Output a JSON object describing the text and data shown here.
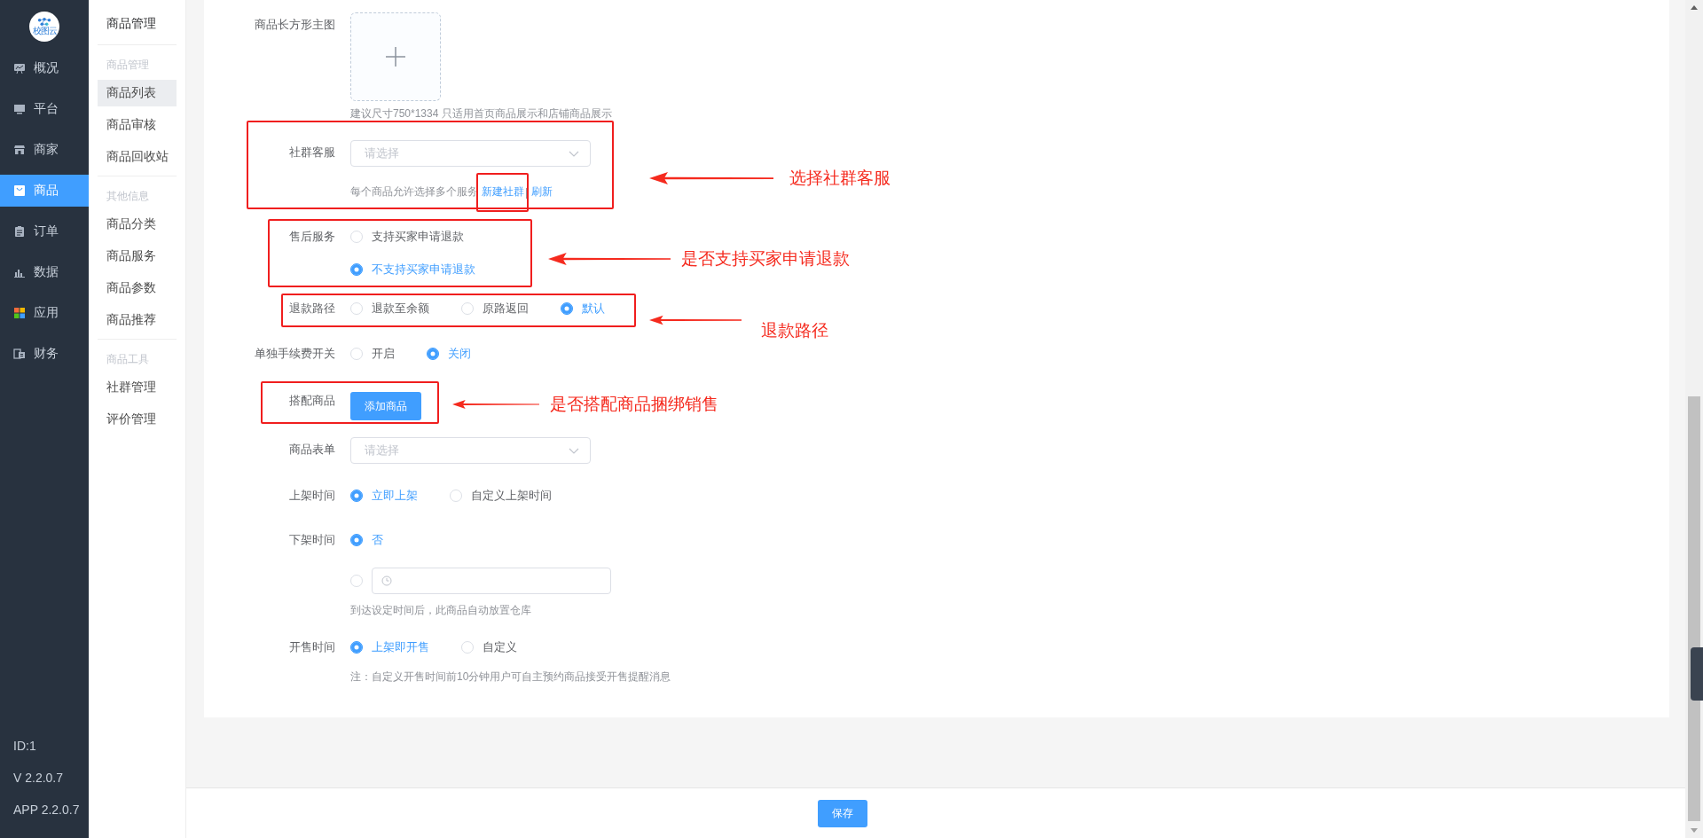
{
  "logo": {
    "text": "校图云"
  },
  "nav": [
    {
      "label": "概况",
      "selected": false
    },
    {
      "label": "平台",
      "selected": false
    },
    {
      "label": "商家",
      "selected": false
    },
    {
      "label": "商品",
      "selected": true
    },
    {
      "label": "订单",
      "selected": false
    },
    {
      "label": "数据",
      "selected": false
    },
    {
      "label": "应用",
      "selected": false
    },
    {
      "label": "财务",
      "selected": false
    }
  ],
  "nav_footer": [
    "ID:1",
    "V 2.2.0.7",
    "APP 2.2.0.7"
  ],
  "submenu": {
    "title": "商品管理",
    "groups": [
      {
        "heading": "商品管理",
        "items": [
          {
            "label": "商品列表",
            "selected": true
          },
          {
            "label": "商品审核",
            "selected": false
          },
          {
            "label": "商品回收站",
            "selected": false
          }
        ]
      },
      {
        "heading": "其他信息",
        "items": [
          {
            "label": "商品分类",
            "selected": false
          },
          {
            "label": "商品服务",
            "selected": false
          },
          {
            "label": "商品参数",
            "selected": false
          },
          {
            "label": "商品推荐",
            "selected": false
          }
        ]
      },
      {
        "heading": "商品工具",
        "items": [
          {
            "label": "社群管理",
            "selected": false
          },
          {
            "label": "评价管理",
            "selected": false
          }
        ]
      }
    ]
  },
  "form": [
    {
      "kind": "upload",
      "label": "商品长方形主图",
      "hint": "建议尺寸750*1334 只适用首页商品展示和店铺商品展示"
    },
    {
      "kind": "select",
      "label": "社群客服",
      "placeholder": "请选择",
      "hint": "每个商品允许选择多个服务",
      "links": [
        "新建社群",
        "刷新"
      ],
      "separator": "|"
    },
    {
      "kind": "radio",
      "label": "售后服务",
      "vertical": true,
      "options": [
        {
          "kind": "text",
          "label": "支持买家申请退款",
          "selected": false
        },
        {
          "kind": "text",
          "label": "不支持买家申请退款",
          "selected": true
        }
      ]
    },
    {
      "kind": "radio",
      "label": "退款路径",
      "vertical": false,
      "options": [
        {
          "kind": "text",
          "label": "退款至余额",
          "selected": false
        },
        {
          "kind": "text",
          "label": "原路返回",
          "selected": false
        },
        {
          "kind": "text",
          "label": "默认",
          "selected": true
        }
      ]
    },
    {
      "kind": "radio",
      "label": "单独手续费开关",
      "vertical": false,
      "options": [
        {
          "kind": "text",
          "label": "开启",
          "selected": false
        },
        {
          "kind": "text",
          "label": "关闭",
          "selected": true
        }
      ]
    },
    {
      "kind": "button",
      "label": "搭配商品",
      "button": "添加商品"
    },
    {
      "kind": "select",
      "label": "商品表单",
      "placeholder": "请选择"
    },
    {
      "kind": "radio",
      "label": "上架时间",
      "vertical": false,
      "options": [
        {
          "kind": "text",
          "label": "立即上架",
          "selected": true
        },
        {
          "kind": "text",
          "label": "自定义上架时间",
          "selected": false
        }
      ]
    },
    {
      "kind": "radio",
      "label": "下架时间",
      "vertical": true,
      "options": [
        {
          "kind": "text",
          "label": "否",
          "selected": true
        },
        {
          "kind": "datetime",
          "selected": false
        }
      ],
      "hint": "到达设定时间后，此商品自动放置仓库"
    },
    {
      "kind": "radio",
      "label": "开售时间",
      "vertical": false,
      "options": [
        {
          "kind": "text",
          "label": "上架即开售",
          "selected": true
        },
        {
          "kind": "text",
          "label": "自定义",
          "selected": false
        }
      ],
      "hint": "注：自定义开售时间前10分钟用户可自主预约商品接受开售提醒消息"
    }
  ],
  "footer": {
    "save": "保存"
  },
  "annotations": [
    {
      "text": "选择社群客服"
    },
    {
      "text": "是否支持买家申请退款"
    },
    {
      "text": "退款路径"
    },
    {
      "text": "是否搭配商品捆绑销售"
    }
  ]
}
